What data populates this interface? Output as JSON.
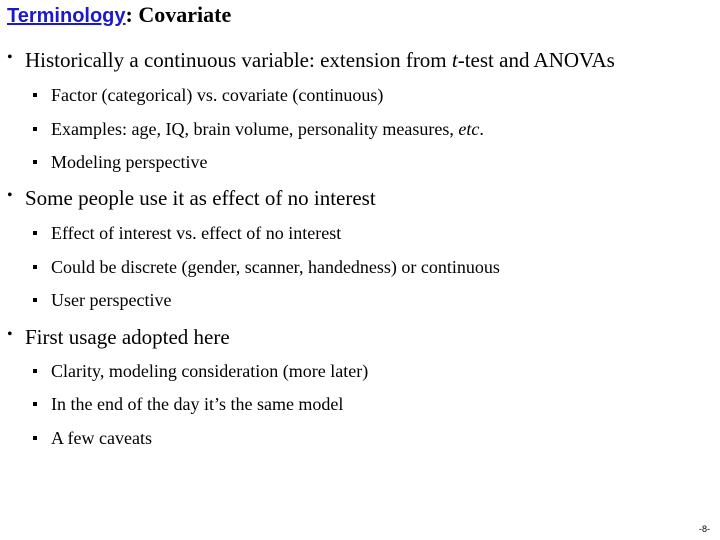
{
  "title": {
    "link": "Terminology",
    "colon": ":",
    "main": " Covariate"
  },
  "sections": [
    {
      "text_before": "Historically a continuous variable: extension from ",
      "text_italic": "t",
      "text_after": "-test and ANOVAs",
      "items": [
        {
          "text": "Factor (categorical) vs. covariate (continuous)"
        },
        {
          "text": "Examples: age, IQ, brain volume, personality measures, ",
          "italic": "etc",
          "suffix": "."
        },
        {
          "text": "Modeling perspective"
        }
      ]
    },
    {
      "text_before": "Some people use it as effect of no interest",
      "items": [
        {
          "text": "Effect of interest vs. effect of no interest"
        },
        {
          "text": "Could be discrete (gender, scanner, handedness) or continuous"
        },
        {
          "text": "User perspective"
        }
      ]
    },
    {
      "text_before": "First usage adopted here",
      "items": [
        {
          "text": "Clarity, modeling consideration (more later)"
        },
        {
          "text": "In the end of the day it’s the same model"
        },
        {
          "text": "A few caveats"
        }
      ]
    }
  ],
  "page_number": "-8-"
}
